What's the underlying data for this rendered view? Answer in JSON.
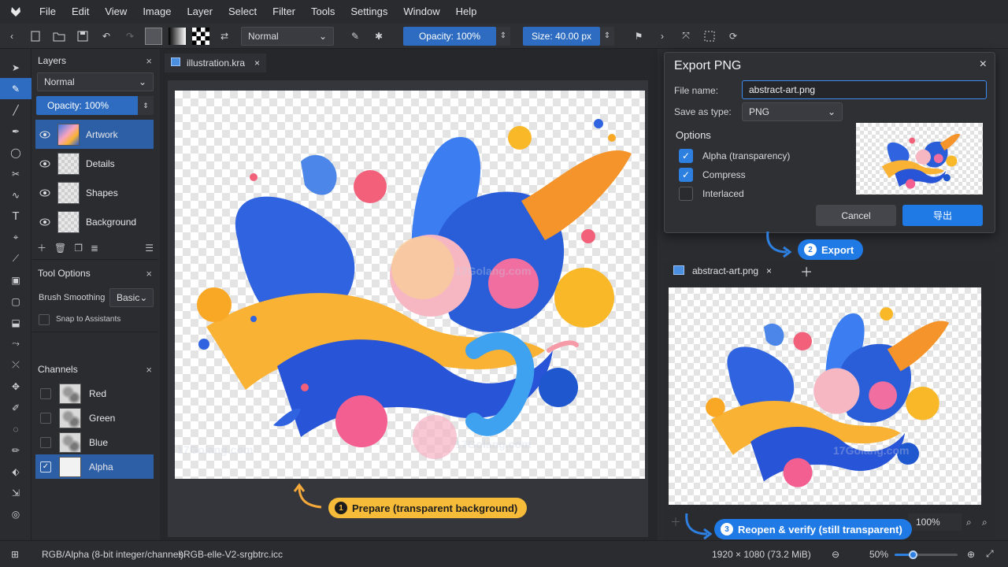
{
  "menu": [
    "File",
    "Edit",
    "View",
    "Image",
    "Layer",
    "Select",
    "Filter",
    "Tools",
    "Settings",
    "Window",
    "Help"
  ],
  "toolbar": {
    "blend_mode": "Normal",
    "opacity": "Opacity: 100%",
    "size": "Size: 40.00 px"
  },
  "layers_panel": {
    "title": "Layers",
    "blend_mode": "Normal",
    "opacity": "Opacity: 100%",
    "layers": [
      {
        "name": "Artwork",
        "active": true
      },
      {
        "name": "Details",
        "active": false
      },
      {
        "name": "Shapes",
        "active": false
      },
      {
        "name": "Background",
        "active": false
      }
    ]
  },
  "tool_options": {
    "title": "Tool Options",
    "smoothing_label": "Brush Smoothing",
    "smoothing_value": "Basic",
    "snap_label": "Snap to Assistants"
  },
  "channels": {
    "title": "Channels",
    "items": [
      {
        "name": "Red",
        "checked": false
      },
      {
        "name": "Green",
        "checked": false
      },
      {
        "name": "Blue",
        "checked": false
      },
      {
        "name": "Alpha",
        "checked": true
      }
    ]
  },
  "document": {
    "tab": "illustration.kra"
  },
  "export_dialog": {
    "title": "Export PNG",
    "file_name_label": "File name:",
    "file_name": "abstract-art.png",
    "type_label": "Save as type:",
    "type_value": "PNG",
    "options_label": "Options",
    "options": [
      {
        "label": "Alpha (transparency)",
        "checked": true
      },
      {
        "label": "Compress",
        "checked": true
      },
      {
        "label": "Interlaced",
        "checked": false
      }
    ],
    "cancel": "Cancel",
    "export": "导出"
  },
  "badges": {
    "prepare": {
      "num": "1",
      "text": "Prepare (transparent background)"
    },
    "export": {
      "num": "2",
      "text": "Export"
    },
    "verify": {
      "num": "3",
      "text": "Reopen & verify (still transparent)"
    }
  },
  "viewer": {
    "tab": "abstract-art.png",
    "zoom": "100%"
  },
  "status": {
    "color_mode": "RGB/Alpha (8-bit integer/channel)",
    "profile": "sRGB-elle-V2-srgbtrc.icc",
    "dimensions": "1920 × 1080 (73.2 MiB)",
    "zoom": "50%",
    "zoom_fraction": 0.3
  },
  "watermark": "17Golang.com",
  "colors": {
    "accent": "#2d6cc0",
    "export_button": "#1f7ae6",
    "badge_orange": "#f7bb3a"
  }
}
